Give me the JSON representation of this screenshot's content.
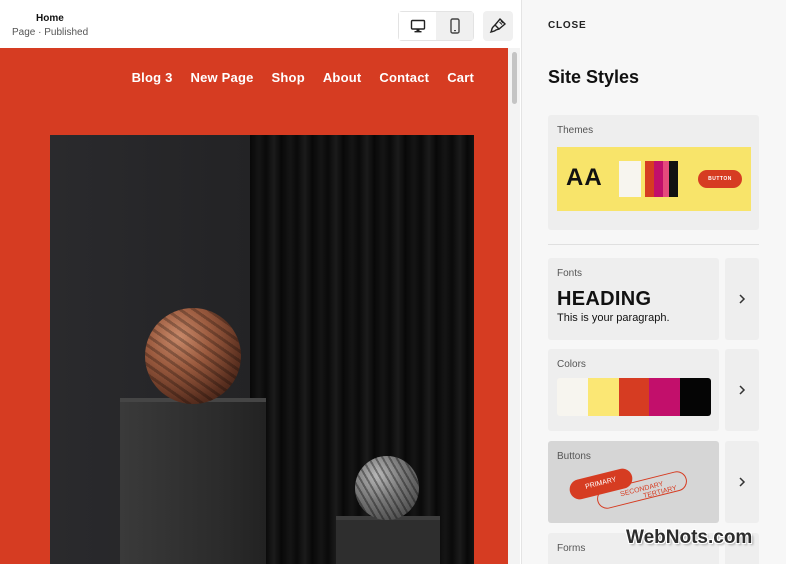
{
  "topbar": {
    "page_title": "Home",
    "page_status": "Page · Published"
  },
  "site": {
    "nav": [
      "Blog 3",
      "New Page",
      "Shop",
      "About",
      "Contact",
      "Cart"
    ],
    "background": "#d63c22"
  },
  "panel": {
    "close_label": "CLOSE",
    "title": "Site Styles",
    "themes": {
      "label": "Themes",
      "preview_aa": "AA",
      "preview_button": "BUTTON",
      "colors": [
        "#f8e46a",
        "#f7f5ef",
        "#d63c22",
        "#c20f6b",
        "#111111"
      ]
    },
    "fonts": {
      "label": "Fonts",
      "heading": "HEADING",
      "paragraph": "This is your paragraph."
    },
    "colors": {
      "label": "Colors",
      "swatches": [
        "#f7f5ef",
        "#fbe774",
        "#d63c22",
        "#c20f6b",
        "#050505"
      ]
    },
    "buttons": {
      "label": "Buttons",
      "primary": "PRIMARY",
      "secondary": "SECONDARY",
      "tertiary": "TERTIARY"
    },
    "forms": {
      "label": "Forms"
    }
  },
  "icons": {
    "desktop": "desktop-icon",
    "mobile": "mobile-icon",
    "brush": "paintbrush-icon",
    "chevron": "chevron-right-icon"
  },
  "watermark": "WebNots.com"
}
